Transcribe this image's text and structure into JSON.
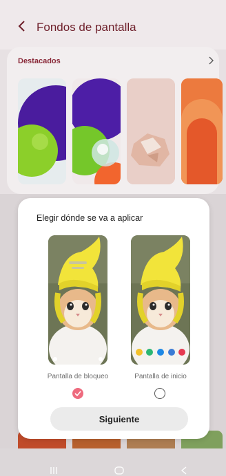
{
  "header": {
    "title": "Fondos de pantalla"
  },
  "featured": {
    "title": "Destacados",
    "wallpapers": [
      "purple-green-spheres",
      "bubble-spheres",
      "rose-quartz-rock",
      "orange-arches"
    ]
  },
  "dialog": {
    "title": "Elegir dónde se va a aplicar",
    "options": [
      {
        "label": "Pantalla de bloqueo",
        "selected": true
      },
      {
        "label": "Pantalla de inicio",
        "selected": false
      }
    ],
    "next_label": "Siguiente"
  },
  "colors": {
    "accent": "#ee6b7e",
    "title": "#6e1f2a",
    "section_title": "#8a2a3a"
  },
  "navbar": {
    "icons": [
      "recents-icon",
      "home-icon",
      "back-icon"
    ]
  }
}
